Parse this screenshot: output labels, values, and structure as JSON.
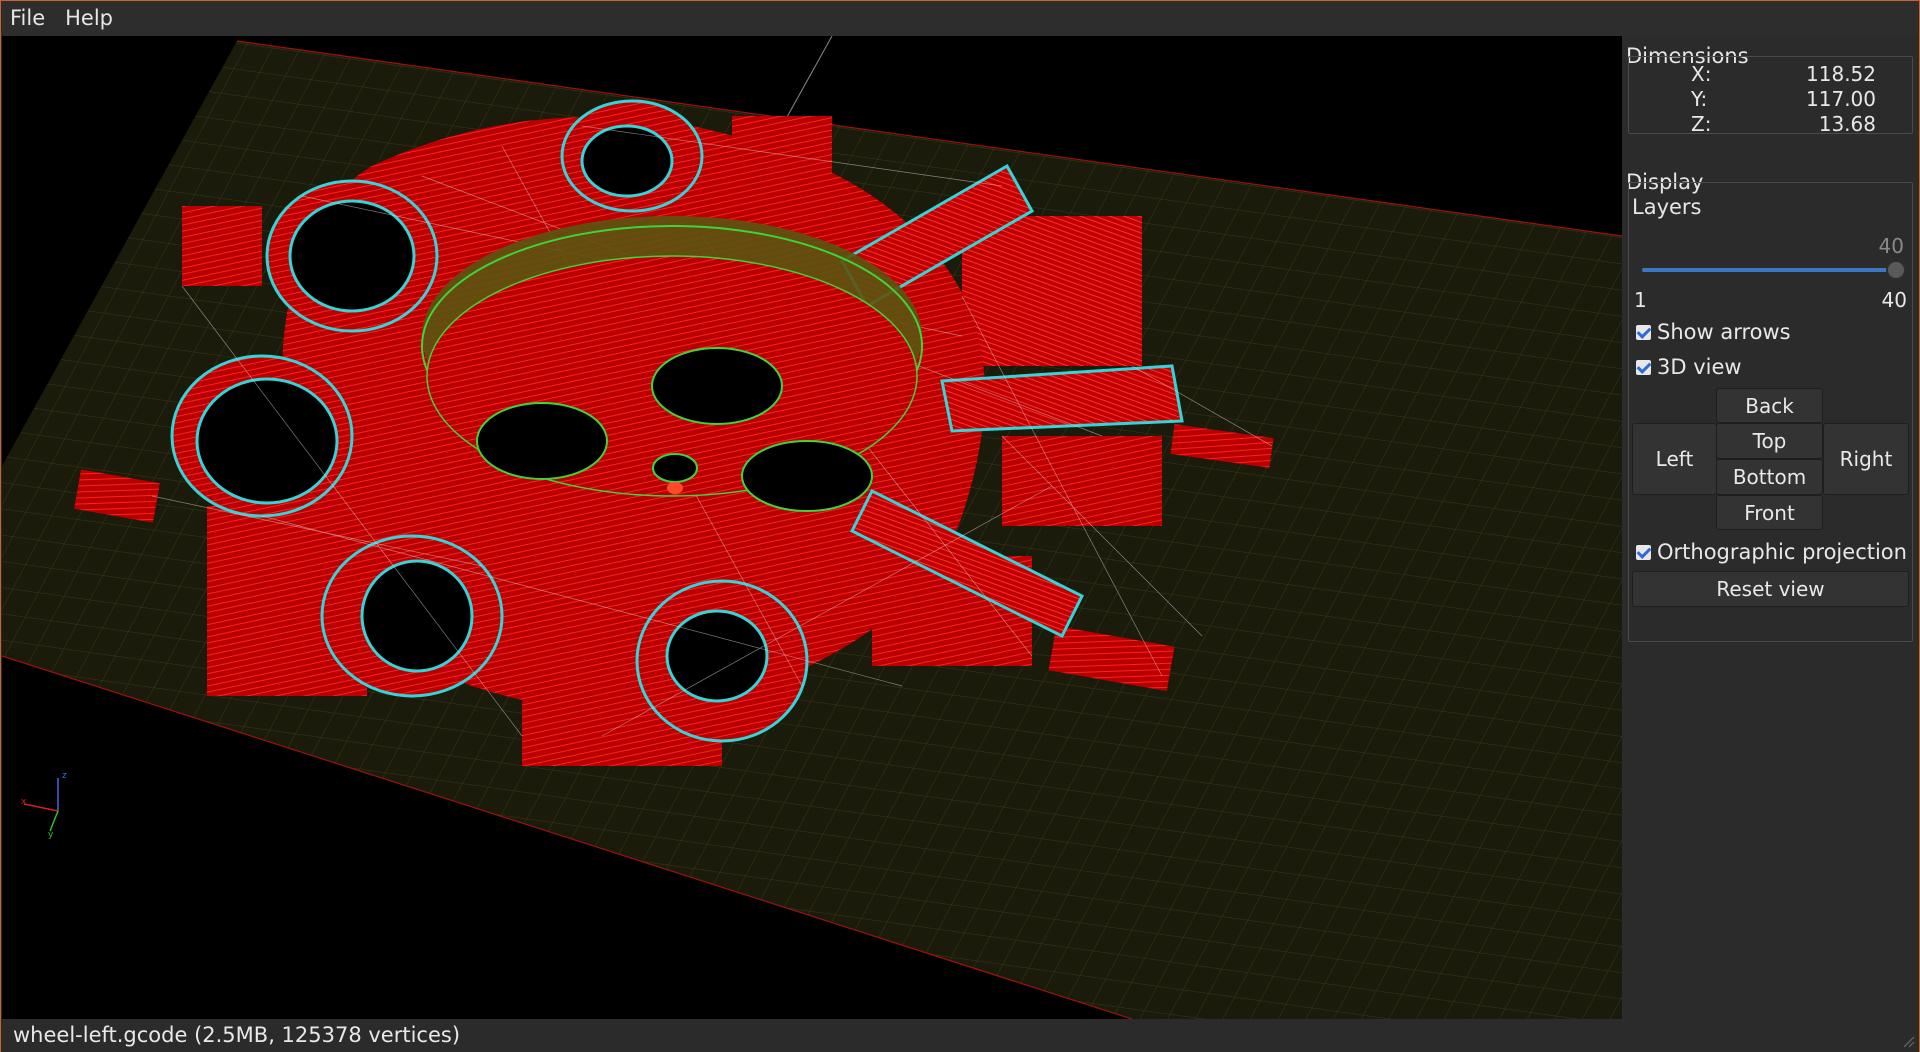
{
  "menubar": {
    "file": "File",
    "help": "Help"
  },
  "dimensions": {
    "title": "Dimensions",
    "x_label": "X:",
    "x_value": "118.52",
    "y_label": "Y:",
    "y_value": "117.00",
    "z_label": "Z:",
    "z_value": "13.68"
  },
  "display": {
    "title": "Display",
    "layers_label": "Layers",
    "layers_current": "40",
    "layers_min": "1",
    "layers_max": "40",
    "layers_value_fraction": 1.0,
    "show_arrows": "Show arrows",
    "view_3d": "3D view",
    "orthographic": "Orthographic projection",
    "reset_view": "Reset view"
  },
  "view_buttons": {
    "back": "Back",
    "left": "Left",
    "top": "Top",
    "right": "Right",
    "bottom": "Bottom",
    "front": "Front"
  },
  "axis_gizmo": {
    "x": "x",
    "y": "y",
    "z": "z"
  },
  "statusbar": {
    "text": "wheel-left.gcode (2.5MB, 125378 vertices)"
  },
  "colors": {
    "window_border": "#c8642a",
    "extrusion": "#ff1a1a",
    "perimeter": "#35d4d8",
    "inner_wall": "#3fd43a",
    "travel": "#e0e0e0",
    "bed_grid": "#4a4a1c"
  }
}
